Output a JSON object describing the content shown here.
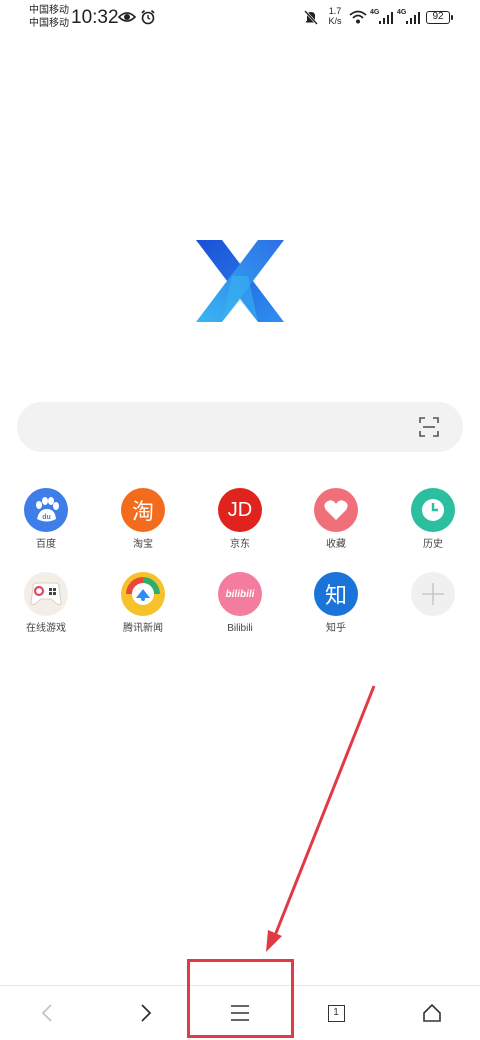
{
  "status_bar": {
    "carrier_1": "中国移动",
    "carrier_2": "中国移动",
    "time": "10:32",
    "net_speed_value": "1.7",
    "net_speed_unit": "K/s",
    "signal_1_type": "4G",
    "signal_2_type": "4G",
    "battery": "92",
    "icons": [
      "eye-icon",
      "alarm-icon",
      "bell-muted-icon",
      "wifi-icon",
      "signal-icon",
      "signal-icon",
      "battery-icon"
    ]
  },
  "logo": {
    "name": "x-logo",
    "colors": [
      "#1a4fd6",
      "#2aa3ef"
    ]
  },
  "search": {
    "placeholder": "",
    "scan_icon": "scan-icon"
  },
  "shortcuts": [
    {
      "label": "百度",
      "icon": "baidu-paw-icon",
      "color": "#3f7ee8"
    },
    {
      "label": "淘宝",
      "icon": "taobao-icon",
      "color": "#f36b1c",
      "glyph": "淘"
    },
    {
      "label": "京东",
      "icon": "jd-icon",
      "color": "#e0231c",
      "glyph": "JD"
    },
    {
      "label": "收藏",
      "icon": "heart-icon",
      "color": "#f0707a"
    },
    {
      "label": "历史",
      "icon": "clock-icon",
      "color": "#2bbf9f"
    },
    {
      "label": "在线游戏",
      "icon": "gamepad-icon",
      "color": "#f3efe8"
    },
    {
      "label": "腾讯新闻",
      "icon": "tencent-news-icon",
      "color": "#f6c12b"
    },
    {
      "label": "Bilibili",
      "icon": "bilibili-icon",
      "color": "#f47c9f",
      "glyph": "bilibili"
    },
    {
      "label": "知乎",
      "icon": "zhihu-icon",
      "color": "#1a73d9",
      "glyph": "知"
    },
    {
      "label": "",
      "icon": "add-icon",
      "color": "#f0f0f0"
    }
  ],
  "bottom_bar": {
    "back_icon": "chevron-left-icon",
    "forward_icon": "chevron-right-icon",
    "menu_icon": "menu-icon",
    "tabs_count": "1",
    "home_icon": "home-icon"
  },
  "annotation": {
    "color": "#e23a44"
  }
}
